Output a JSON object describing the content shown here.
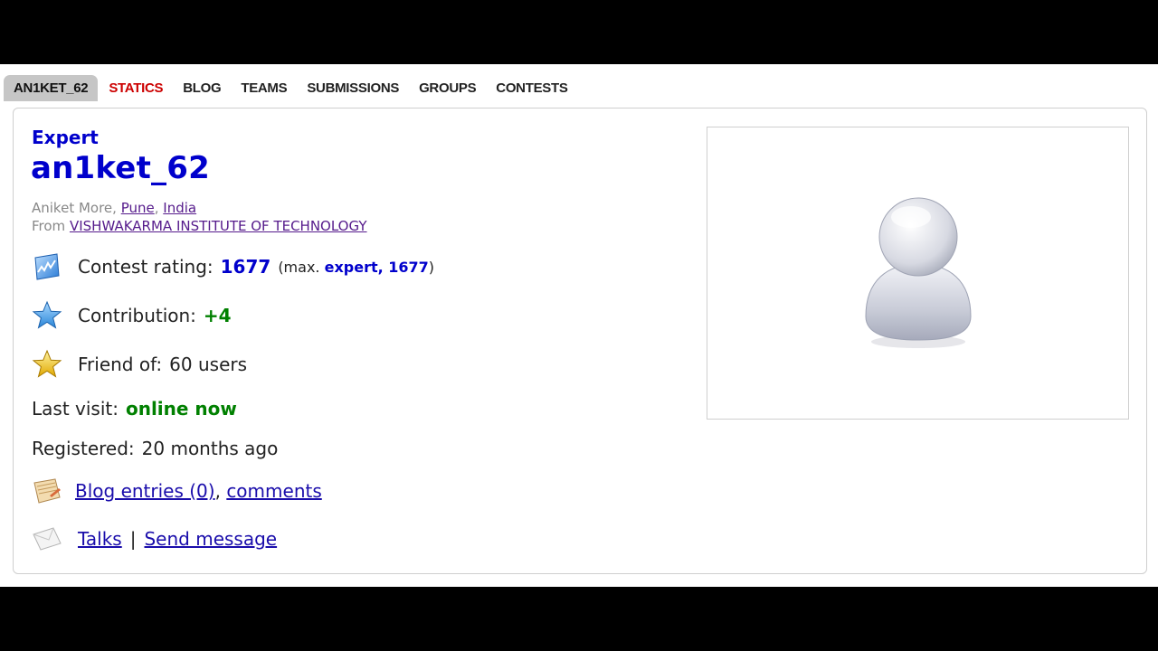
{
  "tabs": [
    {
      "label": "AN1KET_62"
    },
    {
      "label": "STATICS"
    },
    {
      "label": "BLOG"
    },
    {
      "label": "TEAMS"
    },
    {
      "label": "SUBMISSIONS"
    },
    {
      "label": "GROUPS"
    },
    {
      "label": "CONTESTS"
    }
  ],
  "profile": {
    "rank": "Expert",
    "handle": "an1ket_62",
    "name": "Aniket More",
    "city": "Pune",
    "country": "India",
    "from_label": "From",
    "organization": "VISHWAKARMA INSTITUTE OF TECHNOLOGY"
  },
  "stats": {
    "rating_label": "Contest rating:",
    "rating_value": "1677",
    "max_prefix": "(max.",
    "max_value": "expert, 1677",
    "max_suffix": ")",
    "contribution_label": "Contribution:",
    "contribution_value": "+4",
    "friend_label": "Friend of:",
    "friend_value": "60 users",
    "last_visit_label": "Last visit:",
    "last_visit_value": "online now",
    "registered_label": "Registered:",
    "registered_value": "20 months ago"
  },
  "links": {
    "blog_entries": "Blog entries (0)",
    "comments": "comments",
    "talks": "Talks",
    "separator": "|",
    "send_message": "Send message"
  },
  "colors": {
    "rank_color": "#0000cc",
    "positive": "#008000",
    "active_tab_bg": "#c6c6c6",
    "red_tab": "#cc0000"
  }
}
